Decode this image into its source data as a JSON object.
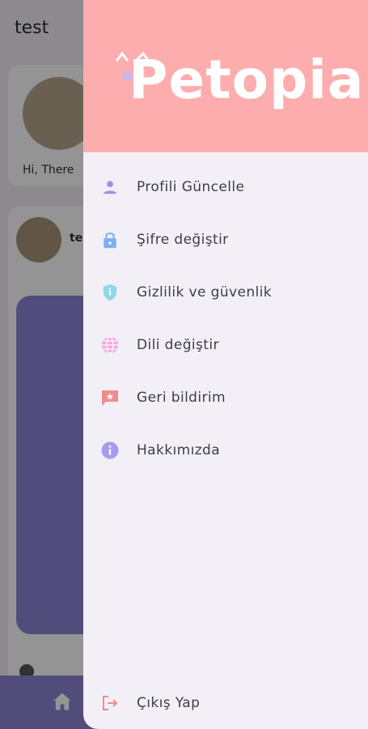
{
  "background": {
    "title": "test",
    "greeting": "Hi, There",
    "post_user": "te"
  },
  "drawer": {
    "logo_text": "Petopia",
    "menu": [
      {
        "label": "Profili Güncelle",
        "icon": "person-icon",
        "color": "#9c8fe8"
      },
      {
        "label": "Şifre değiştir",
        "icon": "lock-icon",
        "color": "#7db0f2"
      },
      {
        "label": "Gizlilik ve güvenlik",
        "icon": "shield-icon",
        "color": "#8fd8e8"
      },
      {
        "label": "Dili değiştir",
        "icon": "globe-icon",
        "color": "#f3a9dd"
      },
      {
        "label": "Geri bildirim",
        "icon": "feedback-icon",
        "color": "#f08c8c"
      },
      {
        "label": "Hakkımızda",
        "icon": "info-icon",
        "color": "#a79bef"
      }
    ],
    "logout": {
      "label": "Çıkış Yap",
      "icon": "logout-icon",
      "color": "#f08c8c"
    }
  },
  "colors": {
    "header": "#fdadae",
    "drawer_bg": "#f2eff7",
    "text": "#3d3d4a"
  }
}
